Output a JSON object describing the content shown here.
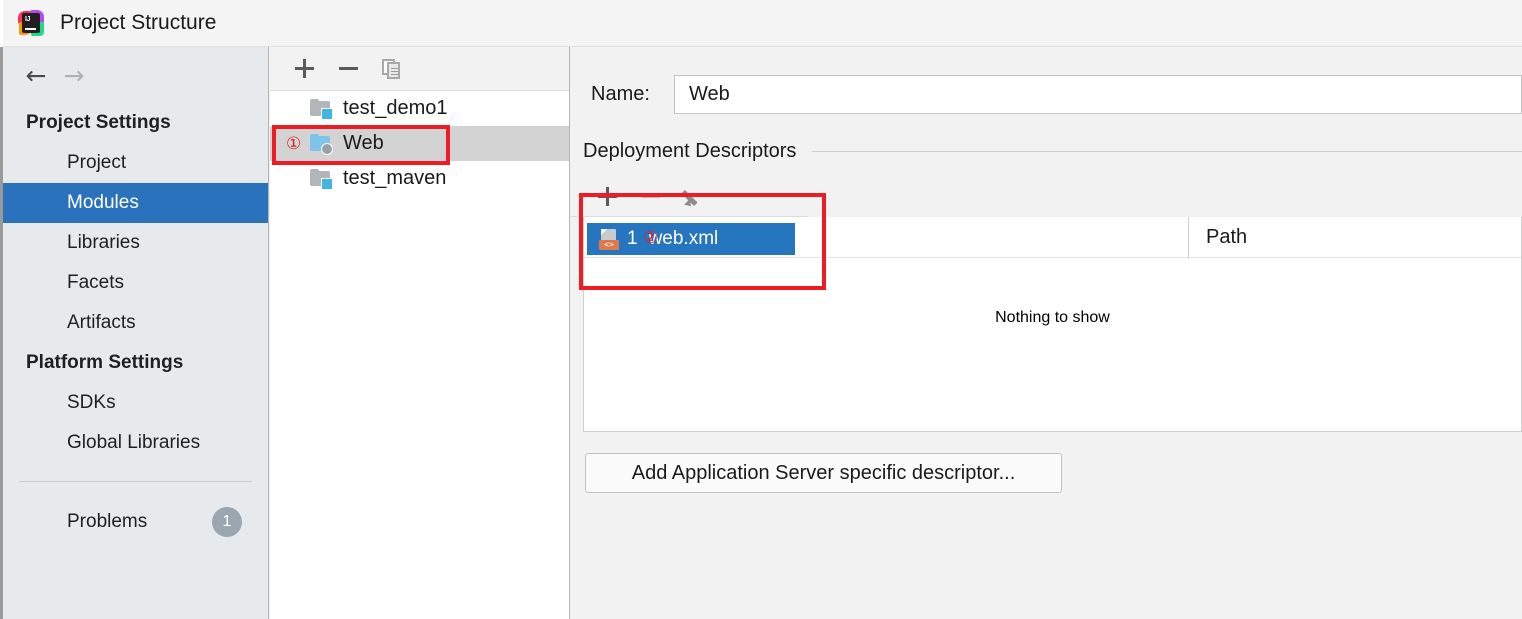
{
  "window": {
    "title": "Project Structure",
    "icon": "intellij-idea-logo"
  },
  "sidebar": {
    "nav": {
      "back_icon": "arrow-left-icon",
      "forward_icon": "arrow-right-icon",
      "back_glyph": "←",
      "forward_glyph": "→"
    },
    "groups": [
      {
        "title": "Project Settings",
        "items": [
          {
            "label": "Project",
            "selected": false
          },
          {
            "label": "Modules",
            "selected": true
          },
          {
            "label": "Libraries",
            "selected": false
          },
          {
            "label": "Facets",
            "selected": false
          },
          {
            "label": "Artifacts",
            "selected": false
          }
        ]
      },
      {
        "title": "Platform Settings",
        "items": [
          {
            "label": "SDKs",
            "selected": false
          },
          {
            "label": "Global Libraries",
            "selected": false
          }
        ]
      }
    ],
    "problems": {
      "label": "Problems",
      "badge": "1"
    },
    "selection_color": "#2a72bc",
    "background_color": "#e6eaed"
  },
  "modules_panel": {
    "toolbar": {
      "add_icon": "plus-icon",
      "remove_icon": "minus-icon",
      "copy_icon": "copy-icon"
    },
    "rows": [
      {
        "label": "test_demo1",
        "icon": "module-folder-icon",
        "marker": "",
        "selected": false
      },
      {
        "label": "Web",
        "icon": "web-module-icon",
        "marker": "①",
        "selected": true
      },
      {
        "label": "test_maven",
        "icon": "module-folder-icon",
        "marker": "",
        "selected": false
      }
    ],
    "selection_color": "#d3d3d3"
  },
  "details": {
    "name_label": "Name:",
    "name_value": "Web",
    "section_title": "Deployment Descriptors",
    "toolbar": {
      "add_icon": "plus-icon",
      "remove_icon": "minus-icon",
      "edit_icon": "pencil-icon"
    },
    "table": {
      "path_column_header": "Path",
      "rows": [
        {
          "number": "1",
          "name": "web.xml",
          "icon": "xml-file-icon",
          "badge_text": "<>",
          "selected": true
        }
      ],
      "empty_text": "Nothing to show",
      "selection_color": "#2675bf"
    },
    "add_descriptor_button": "Add Application Server specific descriptor..."
  },
  "annotations": {
    "marker_1": "①",
    "marker_2": "②",
    "box_color": "#ee1c25"
  }
}
